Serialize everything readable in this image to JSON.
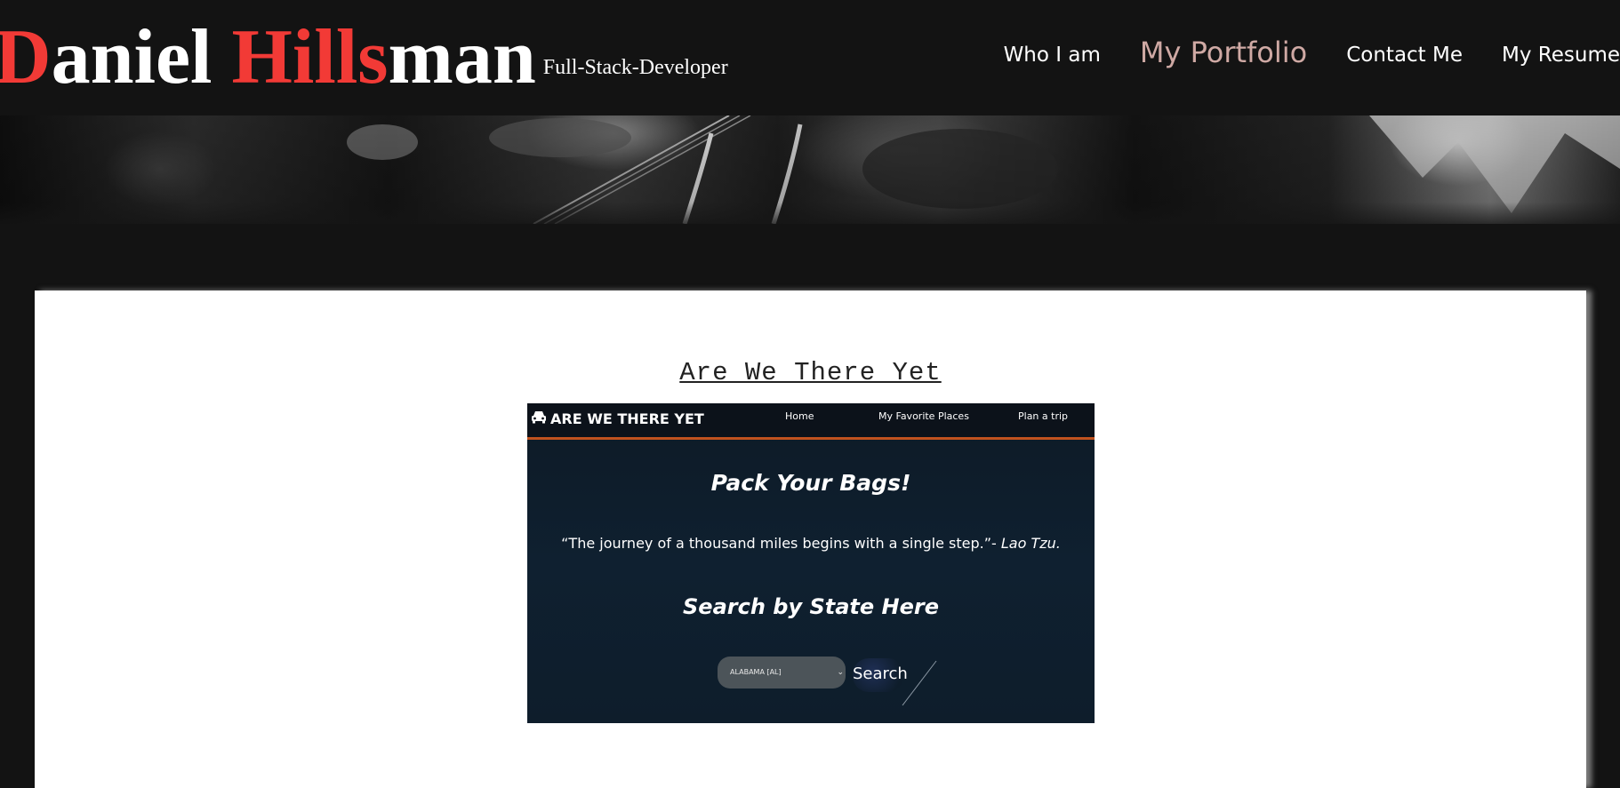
{
  "header": {
    "brand_d": "D",
    "brand_aniel": "aniel ",
    "brand_hills": "Hills",
    "brand_man": "man",
    "subtitle": "Full-Stack-Developer"
  },
  "nav": {
    "items": [
      {
        "label": "Who I am"
      },
      {
        "label": "My Portfolio"
      },
      {
        "label": "Contact Me"
      },
      {
        "label": "My Resume"
      }
    ]
  },
  "project": {
    "title": "Are We There Yet",
    "screenshot": {
      "brand": "ARE WE THERE YET",
      "nav_links": [
        "Home",
        "My Favorite Places",
        "Plan a trip"
      ],
      "heading": "Pack Your Bags!",
      "quote": "“The journey of a thousand miles begins with a single step.”- ",
      "quote_author": "Lao Tzu.",
      "search_heading": "Search by State Here",
      "select_value": "ALABAMA [AL]",
      "search_button": "Search"
    }
  },
  "colors": {
    "background": "#131313",
    "accent_red": "#f23a36",
    "active_nav": "#cfa9a4",
    "card": "#ffffff",
    "shot_bg": "#0f2030",
    "shot_nav_border": "#c0521e"
  },
  "icons": {
    "car": "car-icon",
    "chevron": "chevron-down-icon"
  }
}
